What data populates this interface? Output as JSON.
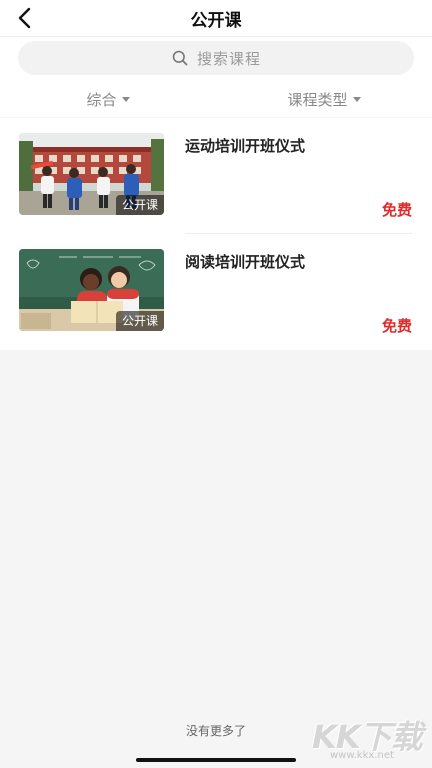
{
  "header": {
    "title": "公开课",
    "back_icon": "chevron-left-icon"
  },
  "search": {
    "placeholder": "搜索课程",
    "icon": "search-icon"
  },
  "filters": [
    {
      "label": "综合"
    },
    {
      "label": "课程类型"
    }
  ],
  "courses": [
    {
      "title": "运动培训开班仪式",
      "tag": "公开课",
      "price": "免费"
    },
    {
      "title": "阅读培训开班仪式",
      "tag": "公开课",
      "price": "免费"
    }
  ],
  "footer": {
    "no_more": "没有更多了"
  },
  "watermark": {
    "brand": "KK下载",
    "url": "www.kkx.net"
  },
  "colors": {
    "accent": "#e02b2b",
    "background": "#f5f5f5"
  }
}
